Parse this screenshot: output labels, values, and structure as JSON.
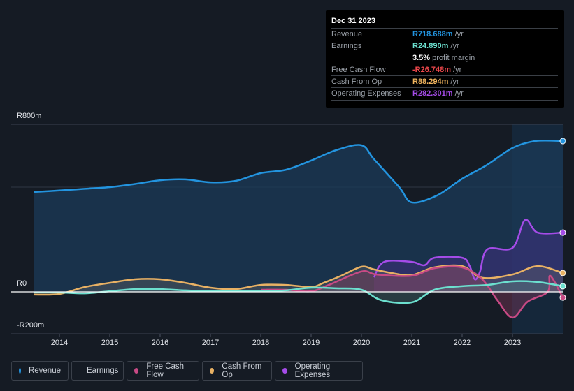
{
  "tooltip": {
    "date": "Dec 31 2023",
    "rows": [
      {
        "label": "Revenue",
        "value": "R718.688m",
        "unit": "/yr",
        "color": "#2394df"
      },
      {
        "label": "Earnings",
        "value": "R24.890m",
        "unit": "/yr",
        "color": "#6ce0cf",
        "extra_value": "3.5%",
        "extra_text": "profit margin"
      },
      {
        "label": "Free Cash Flow",
        "value": "-R26.748m",
        "unit": "/yr",
        "color": "#f0484c"
      },
      {
        "label": "Cash From Op",
        "value": "R88.294m",
        "unit": "/yr",
        "color": "#f0b45e"
      },
      {
        "label": "Operating Expenses",
        "value": "R282.301m",
        "unit": "/yr",
        "color": "#a54ce8"
      }
    ]
  },
  "legend": [
    {
      "label": "Revenue",
      "color": "#2394df"
    },
    {
      "label": "Earnings",
      "color": "#6ce0cf"
    },
    {
      "label": "Free Cash Flow",
      "color": "#c84a85"
    },
    {
      "label": "Cash From Op",
      "color": "#e8b164"
    },
    {
      "label": "Operating Expenses",
      "color": "#a54ce8"
    }
  ],
  "chart_data": {
    "type": "area",
    "title": "",
    "xlabel": "",
    "ylabel": "",
    "ylim": [
      -200,
      800
    ],
    "xlim": [
      2013.5,
      2024.0
    ],
    "y_tick_labels": [
      "R800m",
      "R0",
      "-R200m"
    ],
    "y_ticks": [
      800,
      0,
      -200
    ],
    "x_tick_labels": [
      "2014",
      "2015",
      "2016",
      "2017",
      "2018",
      "2019",
      "2020",
      "2021",
      "2022",
      "2023"
    ],
    "x_ticks": [
      2014,
      2015,
      2016,
      2017,
      2018,
      2019,
      2020,
      2021,
      2022,
      2023
    ],
    "highlight_from": 2023.0,
    "series": [
      {
        "name": "Revenue",
        "color": "#2394df",
        "x": [
          2013.5,
          2014.0,
          2014.5,
          2015.0,
          2015.5,
          2016.0,
          2016.5,
          2017.0,
          2017.5,
          2018.0,
          2018.5,
          2019.0,
          2019.5,
          2020.0,
          2020.25,
          2020.75,
          2021.0,
          2021.5,
          2022.0,
          2022.5,
          2023.0,
          2023.45,
          2024.0
        ],
        "values": [
          477,
          484,
          492,
          500,
          515,
          533,
          537,
          523,
          530,
          567,
          583,
          627,
          677,
          700,
          633,
          500,
          427,
          460,
          540,
          607,
          687,
          720,
          720
        ]
      },
      {
        "name": "Operating Expenses",
        "color": "#a54ce8",
        "x": [
          2020.25,
          2020.45,
          2021.0,
          2021.25,
          2021.45,
          2022.0,
          2022.15,
          2022.25,
          2022.35,
          2022.5,
          2023.0,
          2023.25,
          2023.5,
          2024.0
        ],
        "values": [
          70,
          143,
          143,
          127,
          163,
          163,
          123,
          60,
          93,
          203,
          210,
          343,
          283,
          283
        ]
      },
      {
        "name": "Cash From Op",
        "color": "#e8b164",
        "x": [
          2013.5,
          2014.0,
          2014.5,
          2015.0,
          2015.5,
          2016.0,
          2016.5,
          2017.0,
          2017.5,
          2018.0,
          2018.5,
          2019.0,
          2019.25,
          2019.6,
          2020.0,
          2020.25,
          2020.6,
          2021.0,
          2021.45,
          2022.0,
          2022.4,
          2023.0,
          2023.5,
          2024.0
        ],
        "values": [
          -13,
          -10,
          23,
          43,
          60,
          60,
          43,
          20,
          13,
          33,
          33,
          23,
          43,
          77,
          120,
          107,
          90,
          80,
          117,
          123,
          67,
          83,
          123,
          90
        ]
      },
      {
        "name": "Free Cash Flow",
        "color": "#c84a85",
        "x": [
          2018.0,
          2018.5,
          2019.0,
          2019.35,
          2020.0,
          2020.3,
          2021.0,
          2021.45,
          2022.0,
          2022.4,
          2022.7,
          2023.0,
          2023.3,
          2023.7,
          2023.75,
          2024.0
        ],
        "values": [
          10,
          10,
          3,
          33,
          97,
          83,
          77,
          113,
          117,
          60,
          -40,
          -123,
          -47,
          0,
          77,
          -27
        ]
      },
      {
        "name": "Earnings",
        "color": "#6ce0cf",
        "x": [
          2013.5,
          2014.0,
          2014.5,
          2015.0,
          2015.5,
          2016.0,
          2016.5,
          2017.0,
          2017.5,
          2018.0,
          2018.5,
          2019.0,
          2019.5,
          2020.0,
          2020.4,
          2021.0,
          2021.45,
          2022.0,
          2022.5,
          2023.0,
          2023.5,
          2024.0
        ],
        "values": [
          -3,
          -3,
          -7,
          3,
          13,
          13,
          7,
          3,
          3,
          3,
          7,
          20,
          17,
          10,
          -40,
          -50,
          10,
          27,
          33,
          50,
          47,
          27
        ]
      }
    ]
  }
}
